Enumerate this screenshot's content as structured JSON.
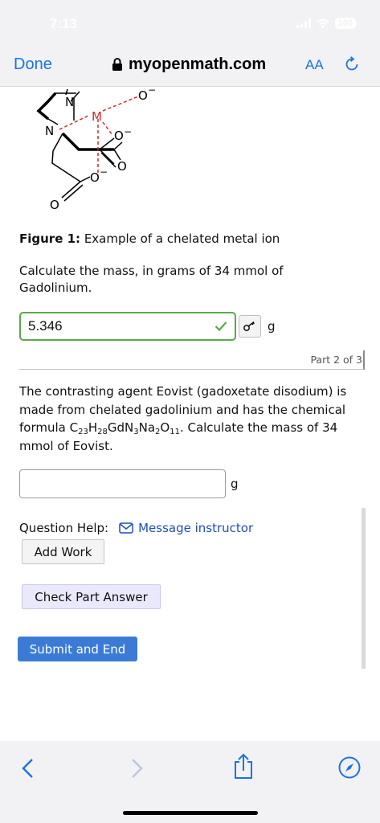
{
  "status_bar": {
    "time": "7:13",
    "battery": "100"
  },
  "browser": {
    "done_label": "Done",
    "url": "myopenmath.com",
    "aa_label": "AA"
  },
  "figure": {
    "caption_label": "Figure 1:",
    "caption_text": "Example of a chelated metal ion",
    "atoms": {
      "n_top": "N",
      "n_left": "N",
      "metal": "M",
      "o_minus_top": "O",
      "o_minus_mid": "O",
      "o_minus_low": "O",
      "o_carbonyl_right": "O",
      "o_carbonyl_bottom": "O",
      "minus": "−"
    }
  },
  "part1": {
    "question": "Calculate the mass, in grams of 34 mmol of Gadolinium.",
    "answer_value": "5.346",
    "unit": "g"
  },
  "part_indicator": "Part 2 of 3",
  "part2": {
    "q_text_1": "The contrasting agent Eovist (gadoxetate disodium) is made from chelated gadolinium and has the chemical formula C",
    "f_23": "23",
    "f_H": "H",
    "f_28": "28",
    "f_GdN": "GdN",
    "f_3": "3",
    "f_Na": "Na",
    "f_2": "2",
    "f_O": "O",
    "f_11": "11",
    "q_text_2": ". Calculate the mass of 34 mmol of Eovist.",
    "answer_value": "",
    "unit": "g"
  },
  "help": {
    "label": "Question Help:",
    "message_link": "Message instructor",
    "add_work": "Add Work",
    "check_part": "Check Part Answer",
    "submit_end": "Submit and End"
  },
  "colors": {
    "accent": "#1a73e8",
    "correct": "#5aa84a",
    "metal": "#d62828",
    "submit_bg": "#3b7bd6"
  }
}
